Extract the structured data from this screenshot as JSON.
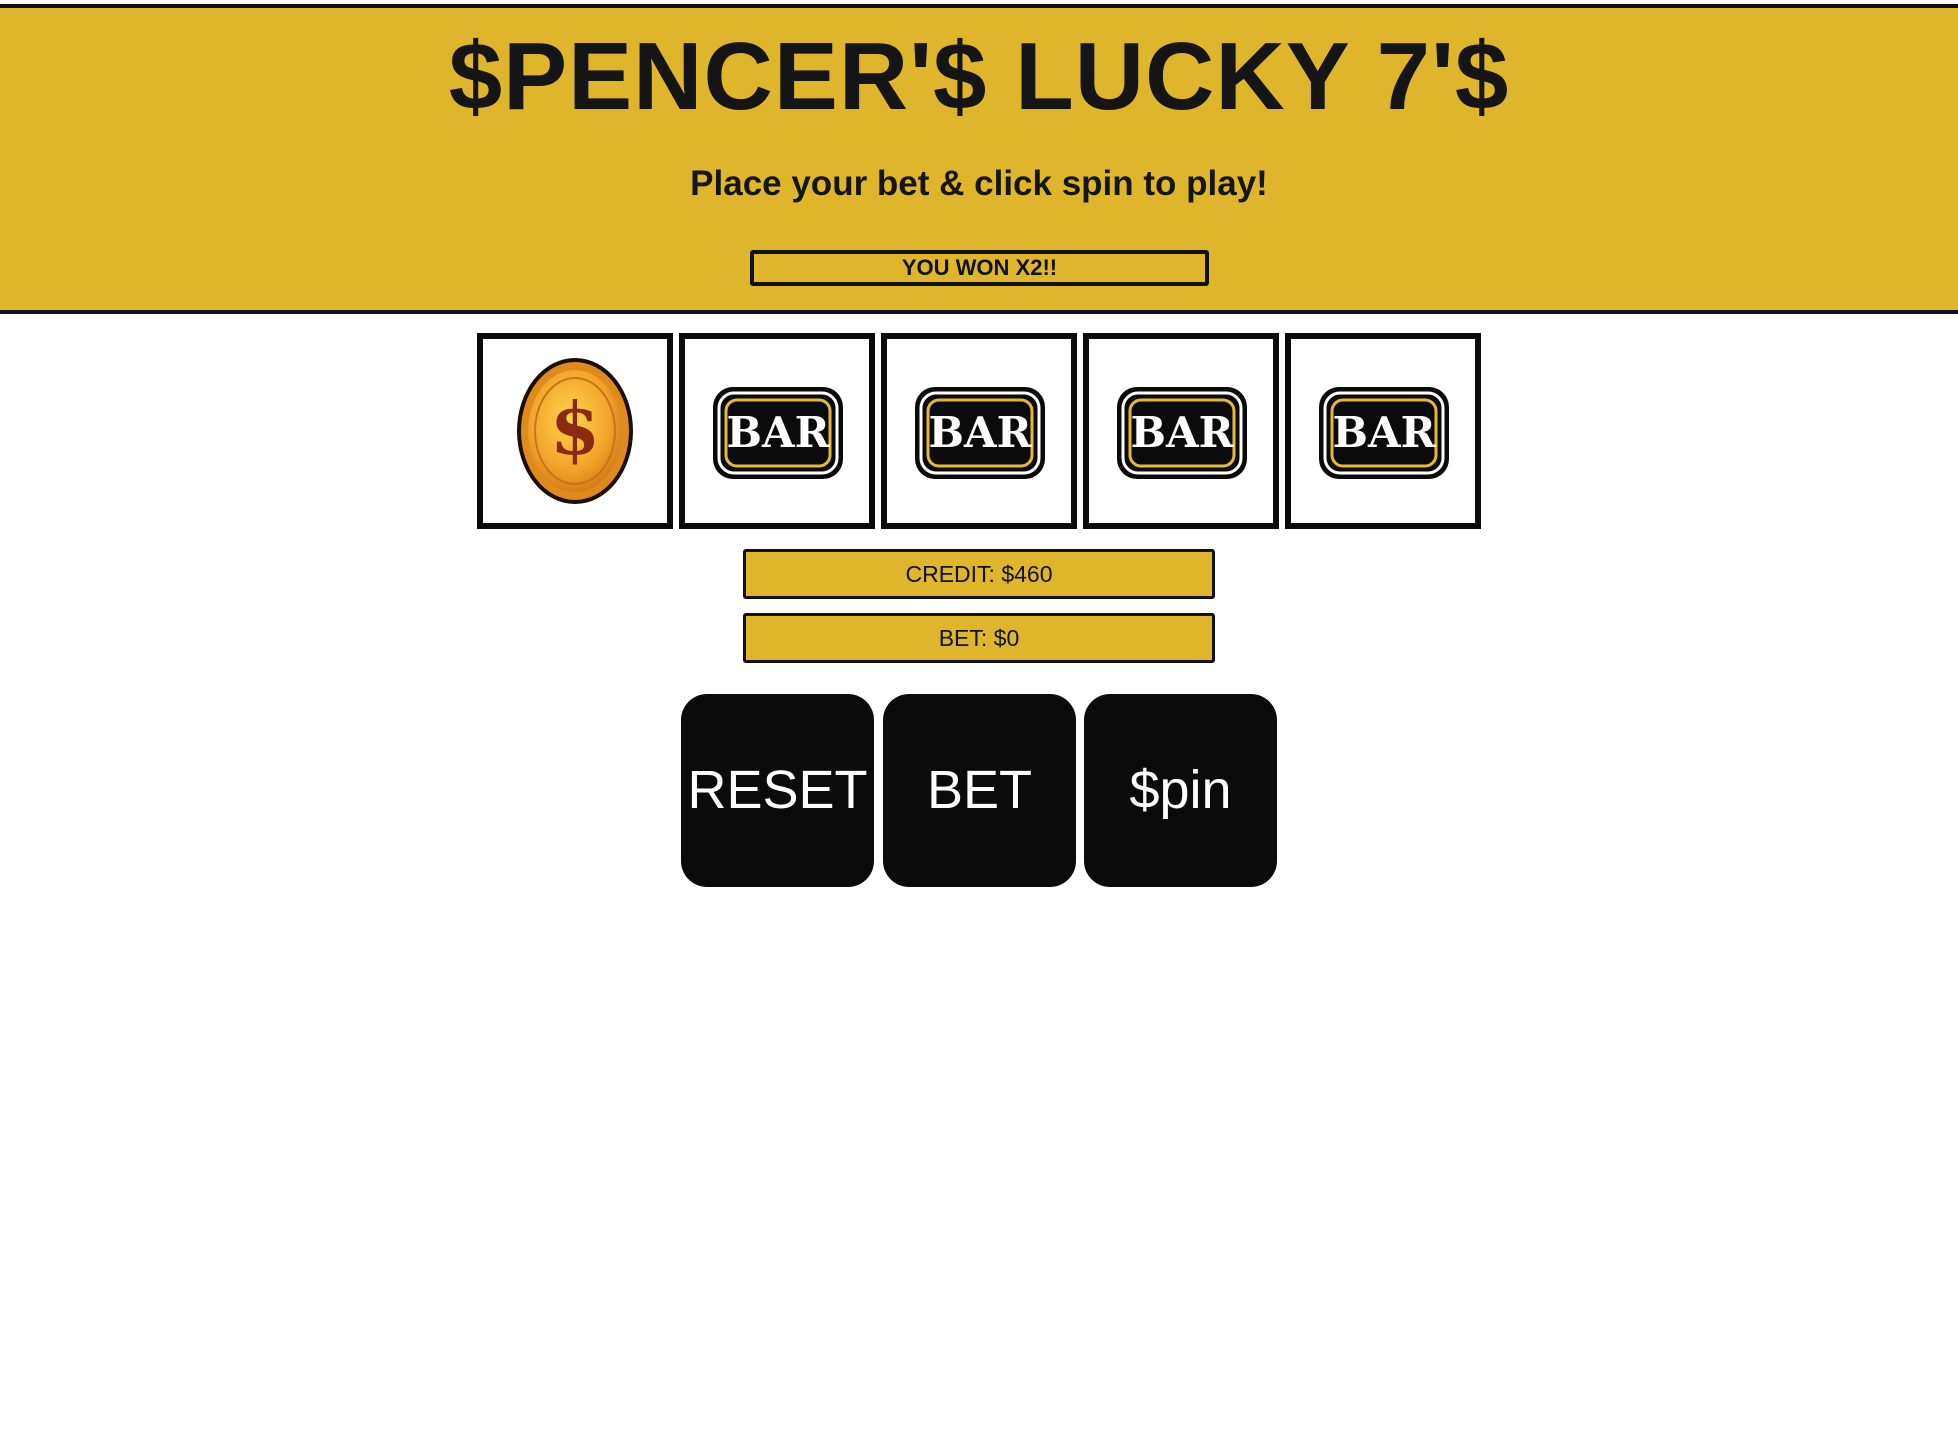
{
  "header": {
    "title": "$PENCER'$ LUCKY 7'$",
    "subtitle": "Place your bet & click spin to play!",
    "message": "YOU WON X2!!"
  },
  "reels": [
    {
      "symbol": "dollar-coin-icon"
    },
    {
      "symbol": "bar-icon",
      "text": "BAR"
    },
    {
      "symbol": "bar-icon",
      "text": "BAR"
    },
    {
      "symbol": "bar-icon",
      "text": "BAR"
    },
    {
      "symbol": "bar-icon",
      "text": "BAR"
    }
  ],
  "meters": {
    "credit": "CREDIT: $460",
    "bet": "BET: $0"
  },
  "buttons": {
    "reset": "RESET",
    "bet": "BET",
    "spin": "$pin"
  },
  "colors": {
    "gold": "#dfb62b",
    "black": "#0b0b0b",
    "white": "#ffffff"
  }
}
